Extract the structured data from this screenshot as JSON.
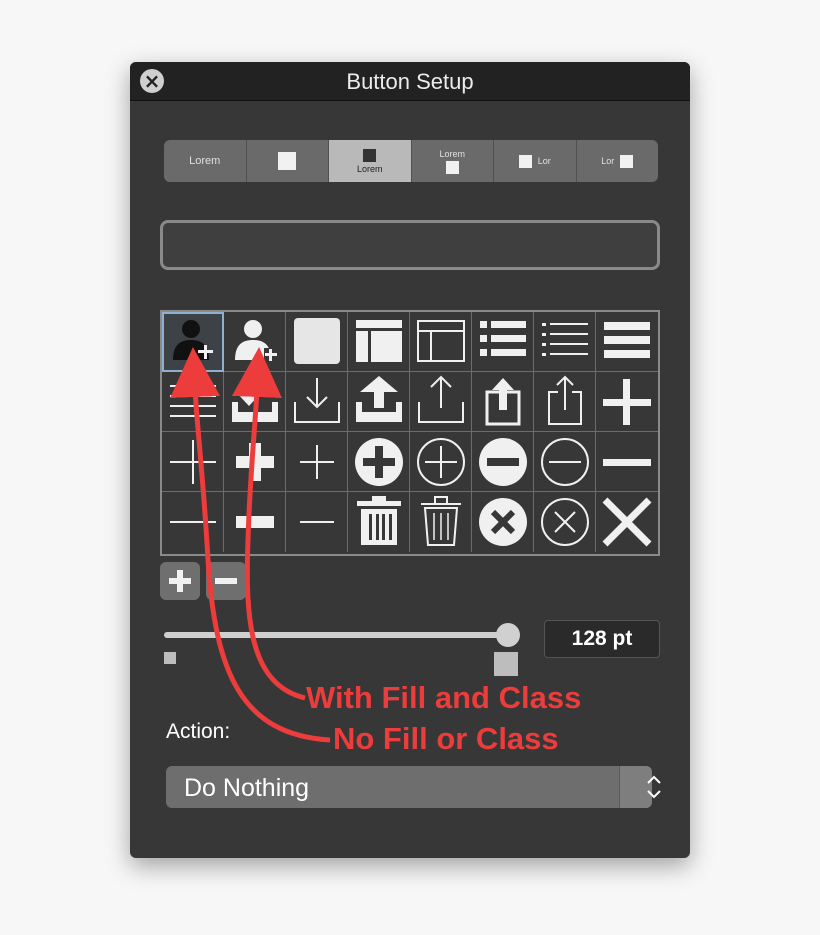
{
  "window": {
    "title": "Button Setup",
    "close_icon": "close-icon"
  },
  "segments": [
    {
      "label": "Lorem",
      "style": "text-only"
    },
    {
      "label": "",
      "style": "icon-only"
    },
    {
      "label": "Lorem",
      "style": "icon-above-text",
      "selected": true
    },
    {
      "label": "Lorem",
      "style": "text-above-icon"
    },
    {
      "label": "Lor",
      "style": "icon-left-text"
    },
    {
      "label": "Lor",
      "style": "text-left-icon"
    }
  ],
  "text_field": {
    "value": ""
  },
  "icon_grid": {
    "selected_index": 0,
    "icons": [
      "user-add-icon",
      "user-add-filled-icon",
      "square-icon",
      "layout-filled-icon",
      "layout-outline-icon",
      "list-bullets-icon",
      "list-dashed-icon",
      "menu-lines-icon",
      "menu-lines-thin-icon",
      "download-filled-icon",
      "download-outline-icon",
      "upload-filled-icon",
      "upload-outline-icon",
      "share-filled-icon",
      "share-outline-icon",
      "plus-thick-icon",
      "plus-thin-icon",
      "plus-block-icon",
      "plus-light-icon",
      "plus-circle-filled-icon",
      "plus-circle-outline-icon",
      "minus-circle-filled-icon",
      "minus-circle-outline-icon",
      "minus-thick-icon",
      "minus-thin-icon",
      "minus-block-icon",
      "minus-light-icon",
      "trash-filled-icon",
      "trash-outline-icon",
      "close-circle-filled-icon",
      "close-circle-outline-icon",
      "close-thick-icon"
    ]
  },
  "list_controls": {
    "add_icon": "plus-icon",
    "remove_icon": "minus-icon"
  },
  "size": {
    "value": "128 pt",
    "slider_fraction": 1.0
  },
  "action": {
    "label": "Action:",
    "selected": "Do Nothing"
  },
  "annotations": {
    "fill_class": "With Fill and Class",
    "no_fill": "No Fill or Class"
  },
  "colors": {
    "annotation": "#ec3c3c",
    "window_bg": "#373737",
    "selection": "#8fb0cf"
  }
}
